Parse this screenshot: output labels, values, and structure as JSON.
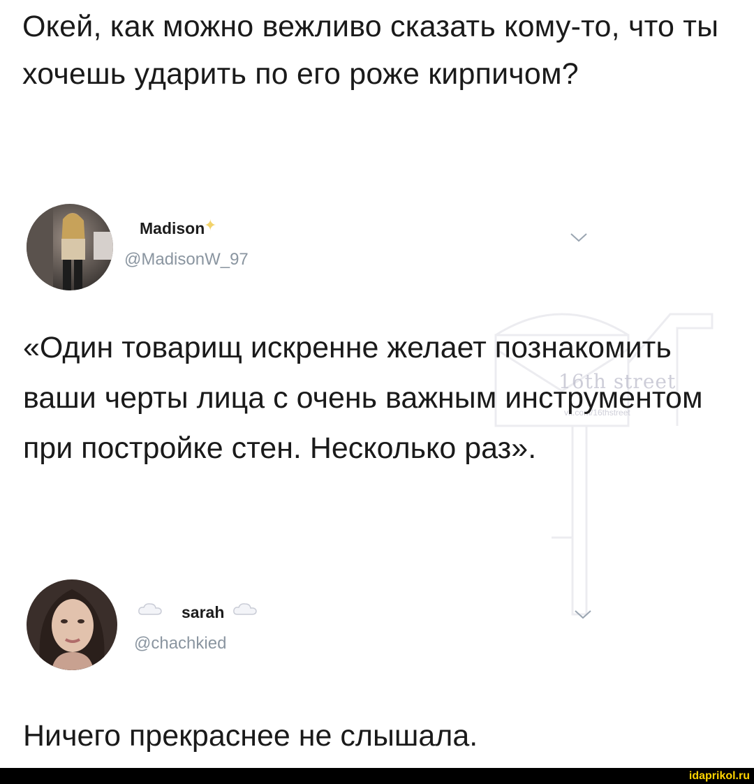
{
  "post": {
    "title_text": "Окей, как можно вежливо сказать кому-то, что ты хочешь ударить по его роже кирпичом?"
  },
  "tweet1": {
    "display_name": "Madison",
    "handle": "@MadisonW_97",
    "name_icon": "sparkle-icon",
    "text": "«Один товарищ  искренне желает познакомить ваши черты лица с очень важным инструментом при постройке стен. Несколько раз»."
  },
  "tweet2": {
    "display_name": "sarah",
    "handle": "@chachkied",
    "name_icon": "cloud-icon",
    "text": "Ничего прекраснее не слышала."
  },
  "watermark": {
    "stamp": "16th street",
    "url": "vk.com/16thstreet"
  },
  "footer": {
    "site": "idaprikol.ru"
  },
  "colors": {
    "text": "#1a1a1a",
    "handle": "#8a95a0",
    "footer_bg": "#000000",
    "footer_logo": "#ffd400"
  }
}
